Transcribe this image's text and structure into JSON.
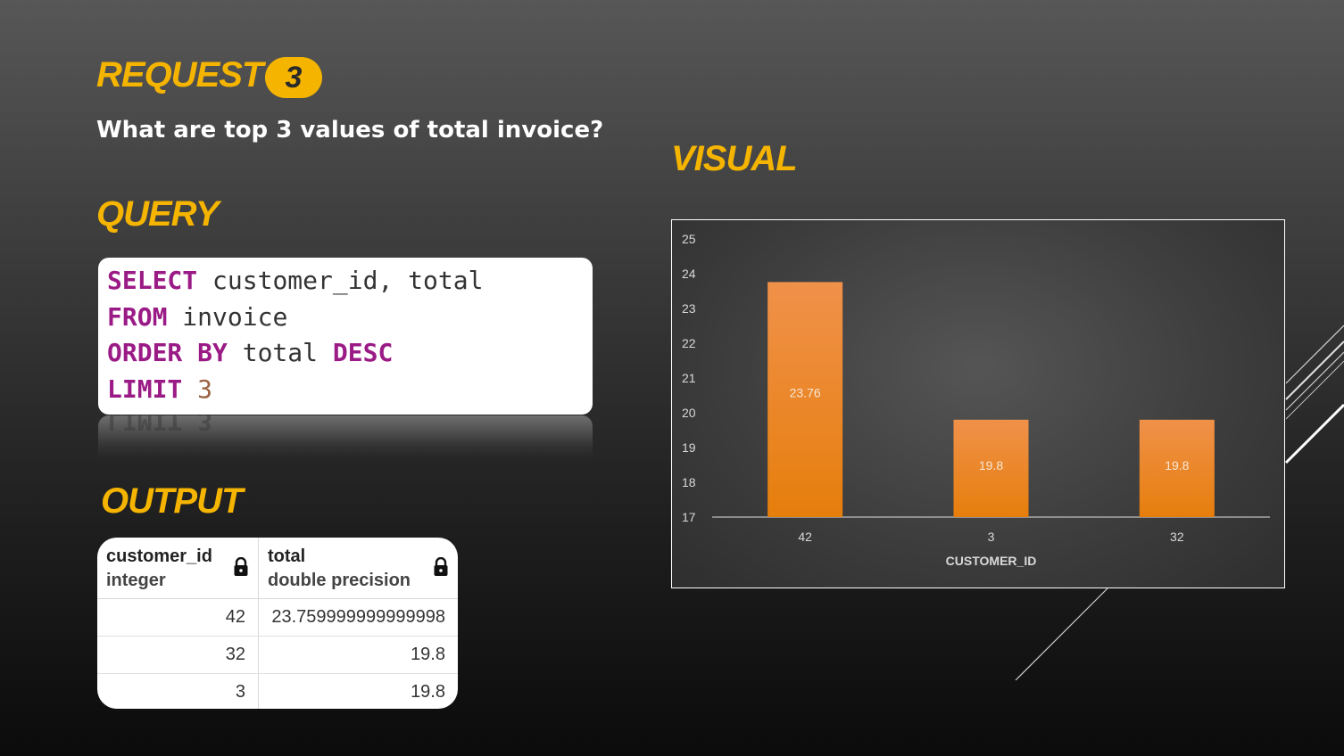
{
  "request": {
    "label": "REQUEST",
    "number": "3"
  },
  "question": "What are top 3 values of total invoice?",
  "query_heading": "QUERY",
  "query": {
    "lines": [
      [
        {
          "t": "SELECT",
          "k": "kw"
        },
        {
          "t": " customer_id, total",
          "k": "id"
        }
      ],
      [
        {
          "t": "FROM",
          "k": "kw"
        },
        {
          "t": " invoice",
          "k": "id"
        }
      ],
      [
        {
          "t": "ORDER BY",
          "k": "kw"
        },
        {
          "t": " total ",
          "k": "id"
        },
        {
          "t": "DESC",
          "k": "kw"
        }
      ],
      [
        {
          "t": "LIMIT",
          "k": "kw"
        },
        {
          "t": " ",
          "k": "id"
        },
        {
          "t": "3",
          "k": "num"
        }
      ]
    ],
    "reflection_text": "LIMIT 3"
  },
  "output_heading": "OUTPUT",
  "output_table": {
    "columns": [
      {
        "name": "customer_id",
        "type": "integer"
      },
      {
        "name": "total",
        "type": "double precision"
      }
    ],
    "rows": [
      [
        "42",
        "23.759999999999998"
      ],
      [
        "32",
        "19.8"
      ],
      [
        "3",
        "19.8"
      ]
    ]
  },
  "visual_heading": "VISUAL",
  "colors": {
    "heading": "#f4b400",
    "bar": "#e67e0c",
    "keyword": "#9b1b86",
    "number": "#9a6242"
  },
  "chart_data": {
    "type": "bar",
    "categories": [
      "42",
      "3",
      "32"
    ],
    "values": [
      23.76,
      19.8,
      19.8
    ],
    "data_labels": [
      "23.76",
      "19.8",
      "19.8"
    ],
    "xlabel": "CUSTOMER_ID",
    "ylabel": "",
    "ylim": [
      17,
      25
    ],
    "yticks": [
      17,
      18,
      19,
      20,
      21,
      22,
      23,
      24,
      25
    ],
    "grid": false,
    "legend": "none"
  }
}
